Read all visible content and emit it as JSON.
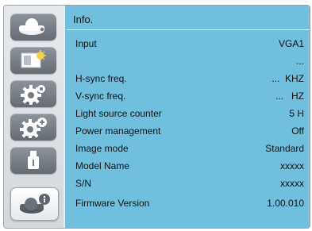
{
  "sidebar": {
    "items": [
      {
        "name": "picture",
        "icon": "projector-icon",
        "active": false
      },
      {
        "name": "image-adjust",
        "icon": "image-adjust-icon",
        "active": false
      },
      {
        "name": "setting",
        "icon": "gear-icon",
        "active": false
      },
      {
        "name": "expanded-setting",
        "icon": "gear-plus-icon",
        "active": false
      },
      {
        "name": "usb",
        "icon": "usb-icon",
        "active": false
      },
      {
        "name": "info",
        "icon": "projector-info-icon",
        "active": true
      }
    ]
  },
  "panel": {
    "title": "Info.",
    "rows": [
      {
        "label": "Input",
        "value": "VGA1"
      },
      {
        "label": "",
        "value": "..."
      },
      {
        "label": "H-sync freq.",
        "value": "...  KHZ"
      },
      {
        "label": "V-sync freq.",
        "value": "...   HZ"
      },
      {
        "label": "Light source counter",
        "value": "5 H"
      },
      {
        "label": "Power management",
        "value": "Off"
      },
      {
        "label": "Image mode",
        "value": "Standard"
      },
      {
        "label": "Model Name",
        "value": "xxxxx"
      },
      {
        "label": "S/N",
        "value": "xxxxx"
      },
      {
        "label": "Firmware Version",
        "value": "1.00.010"
      }
    ]
  },
  "colors": {
    "panel_bg": "#71bfdf",
    "sidebar_button": "#7a8189",
    "active_button": "#f4f6f8"
  }
}
